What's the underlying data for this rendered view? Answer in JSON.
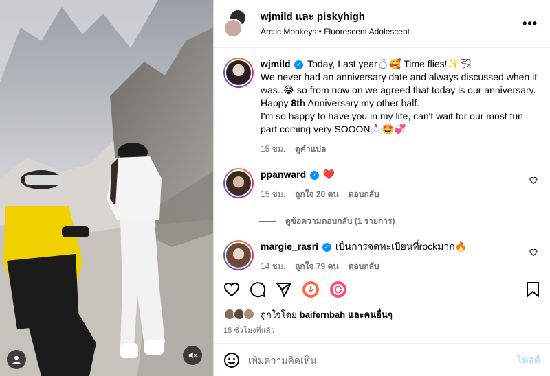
{
  "header": {
    "title": "wjmild และ piskyhigh",
    "subtitle": "Arctic Monkeys • Fluorescent Adolescent",
    "more_icon": "more-horizontal-icon"
  },
  "caption": {
    "username": "wjmild",
    "line1": "Today, Last year💍🥰 Time flies!✨🌫",
    "line2": "We never had an anniversary date and always discussed when it was..😂 so from now on we agreed that today is our anniversary.",
    "line3_pre": "Happy ",
    "line3_bold": "8th",
    "line3_post": " Anniversary my other half.",
    "line4": "I'm so happy to have you in my life, can't wait for our most fun part coming very SOOON📩🤩💞",
    "time": "15 ชม.",
    "translate": "ดูคำแปล"
  },
  "comments": [
    {
      "username": "ppanward",
      "text": "❤️",
      "time": "15 ชม.",
      "likes": "ถูกใจ 20 คน",
      "reply": "ตอบกลับ"
    },
    {
      "username": "margie_rasri",
      "text": "เป็นการจดทะเบียนที่rockมาก🔥",
      "time": "14 ชม.",
      "likes": "ถูกใจ 79 คน",
      "reply": "ตอบกลับ"
    }
  ],
  "replies_toggle": "ดูข้อความตอบกลับ (1 รายการ)",
  "liked_by": {
    "prefix": "ถูกใจโดย ",
    "user": "baifernbah",
    "suffix": " และคนอื่นๆ"
  },
  "time_ago": "15 ชั่วโมงที่แล้ว",
  "comment_box": {
    "placeholder": "เพิ่มความคิดเห็น",
    "post_label": "โพสต์"
  },
  "colors": {
    "verified": "#0095f6",
    "heart": "#ed4956",
    "muted": "#737373"
  }
}
